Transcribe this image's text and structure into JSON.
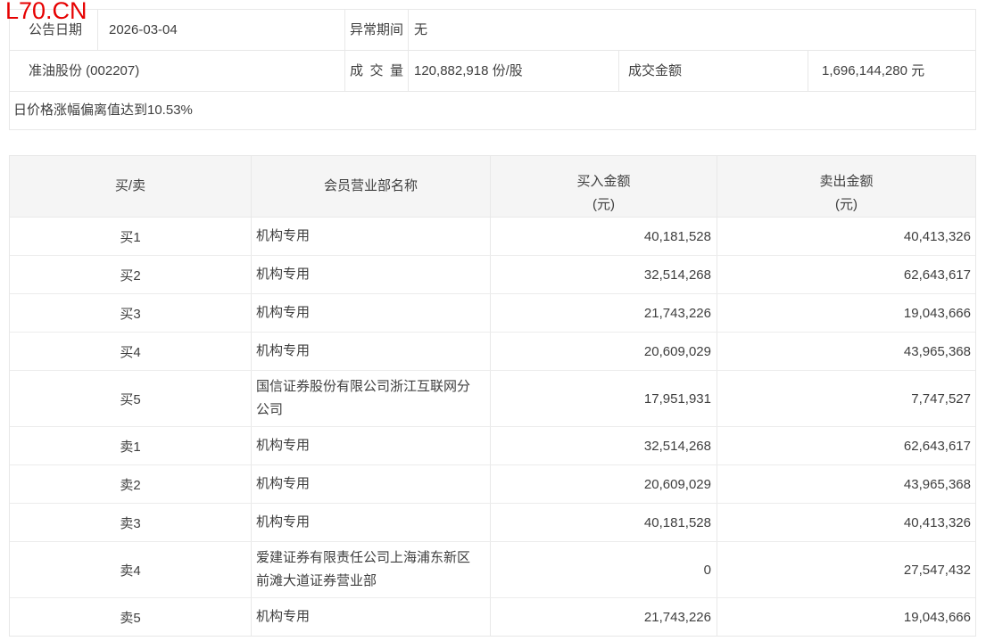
{
  "watermark": "L70.CN",
  "info": {
    "announce_date_label": "公告日期",
    "announce_date_value": "2026-03-04",
    "abnormal_period_label": "异常期间",
    "abnormal_period_value": "无",
    "stock_name": "准油股份 (002207)",
    "volume_label": "成交量",
    "volume_value": "120,882,918 份/股",
    "turnover_label": "成交金额",
    "turnover_value": "1,696,144,280 元",
    "deviation_note": "日价格涨幅偏离值达到10.53%"
  },
  "table": {
    "headers": {
      "side": "买/卖",
      "branch": "会员营业部名称",
      "buy": "买入金额",
      "buy_unit": "(元)",
      "sell": "卖出金额",
      "sell_unit": "(元)"
    },
    "rows": [
      {
        "side": "买1",
        "branch": "机构专用",
        "buy": "40,181,528",
        "sell": "40,413,326"
      },
      {
        "side": "买2",
        "branch": "机构专用",
        "buy": "32,514,268",
        "sell": "62,643,617"
      },
      {
        "side": "买3",
        "branch": "机构专用",
        "buy": "21,743,226",
        "sell": "19,043,666"
      },
      {
        "side": "买4",
        "branch": "机构专用",
        "buy": "20,609,029",
        "sell": "43,965,368"
      },
      {
        "side": "买5",
        "branch": "国信证券股份有限公司浙江互联网分公司",
        "buy": "17,951,931",
        "sell": "7,747,527"
      },
      {
        "side": "卖1",
        "branch": "机构专用",
        "buy": "32,514,268",
        "sell": "62,643,617"
      },
      {
        "side": "卖2",
        "branch": "机构专用",
        "buy": "20,609,029",
        "sell": "43,965,368"
      },
      {
        "side": "卖3",
        "branch": "机构专用",
        "buy": "40,181,528",
        "sell": "40,413,326"
      },
      {
        "side": "卖4",
        "branch": "爱建证券有限责任公司上海浦东新区前滩大道证券营业部",
        "buy": "0",
        "sell": "27,547,432"
      },
      {
        "side": "卖5",
        "branch": "机构专用",
        "buy": "21,743,226",
        "sell": "19,043,666"
      }
    ]
  },
  "colors": {
    "accent_red": "#e60000",
    "header_bg": "#f5f5f5",
    "border": "#e8e8e8",
    "text": "#3e3e3e"
  }
}
